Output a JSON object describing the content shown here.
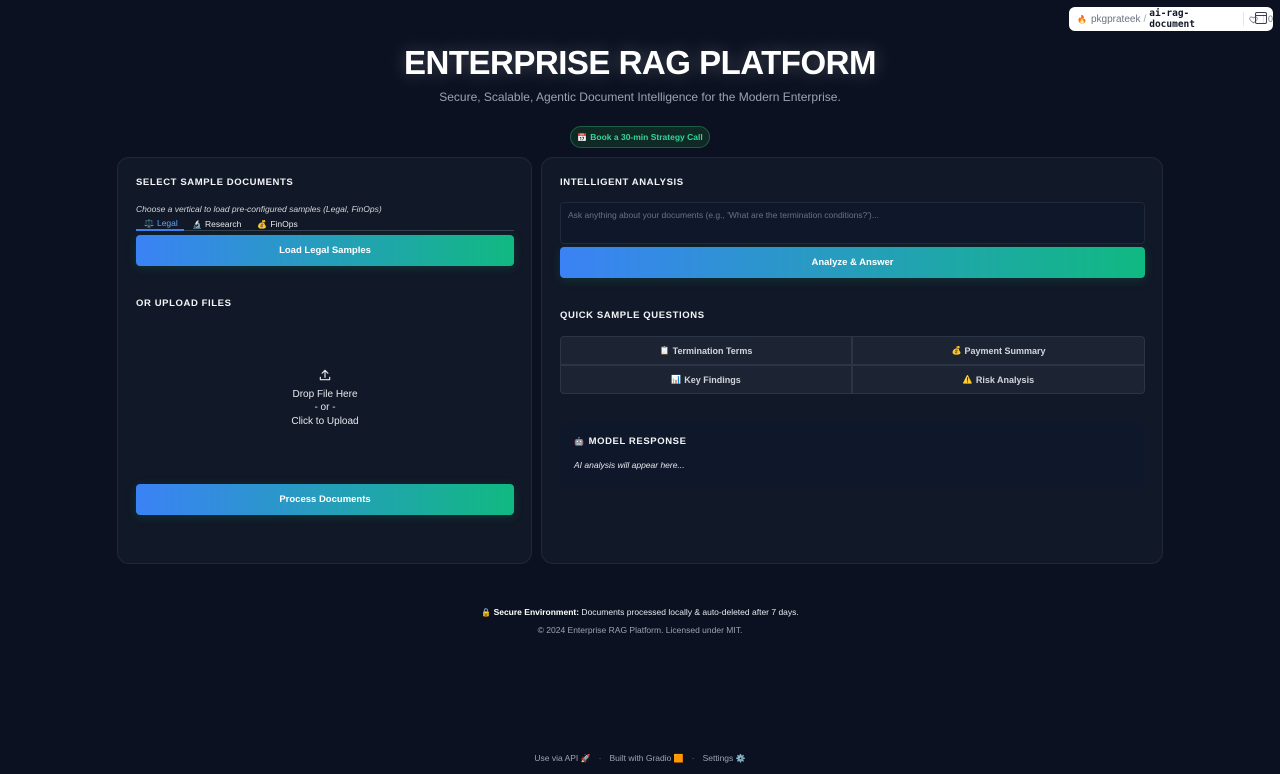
{
  "space_badge": {
    "owner": "pkgprateek",
    "separator": "/",
    "repo": "ai-rag-document",
    "likes": "0"
  },
  "header": {
    "title": "ENTERPRISE RAG PLATFORM",
    "subtitle": "Secure, Scalable, Agentic Document Intelligence for the Modern Enterprise.",
    "cta_icon": "📅",
    "cta_label": "Book a 30-min Strategy Call"
  },
  "left_panel": {
    "section_title": "SELECT SAMPLE DOCUMENTS",
    "hint": "Choose a vertical to load pre-configured samples (Legal, FinOps)",
    "tabs": [
      {
        "icon": "⚖️",
        "label": "Legal",
        "active": true
      },
      {
        "icon": "🔬",
        "label": "Research",
        "active": false
      },
      {
        "icon": "💰",
        "label": "FinOps",
        "active": false
      }
    ],
    "load_button": "Load Legal Samples",
    "upload_title": "OR UPLOAD FILES",
    "upload_line1": "Drop File Here",
    "upload_line2": "- or -",
    "upload_line3": "Click to Upload",
    "process_button": "Process Documents"
  },
  "right_panel": {
    "section_title": "INTELLIGENT ANALYSIS",
    "question_placeholder": "Ask anything about your documents (e.g., 'What are the termination conditions?')...",
    "analyze_button": "Analyze & Answer",
    "quick_title": "QUICK SAMPLE QUESTIONS",
    "quick_questions": [
      {
        "icon": "📋",
        "label": "Termination Terms"
      },
      {
        "icon": "💰",
        "label": "Payment Summary"
      },
      {
        "icon": "📊",
        "label": "Key Findings"
      },
      {
        "icon": "⚠️",
        "label": "Risk Analysis"
      }
    ],
    "response_icon": "🤖",
    "response_title": "MODEL RESPONSE",
    "response_body": "AI analysis will appear here..."
  },
  "footer": {
    "lock_icon": "🔒",
    "secure_label": "Secure Environment:",
    "secure_text": " Documents processed locally & auto-deleted after 7 days.",
    "copyright": "© 2024 Enterprise RAG Platform. Licensed under MIT.",
    "links": [
      {
        "label": "Use via API",
        "icon": "🚀"
      },
      {
        "label": "Built with Gradio",
        "icon": "🟧"
      },
      {
        "label": "Settings",
        "icon": "⚙️"
      }
    ],
    "separator": "·"
  },
  "colors": {
    "background": "#0b1120",
    "panel": "#111827",
    "accent_blue": "#3b82f6",
    "accent_green": "#10b981",
    "cta_green": "#34d399"
  }
}
